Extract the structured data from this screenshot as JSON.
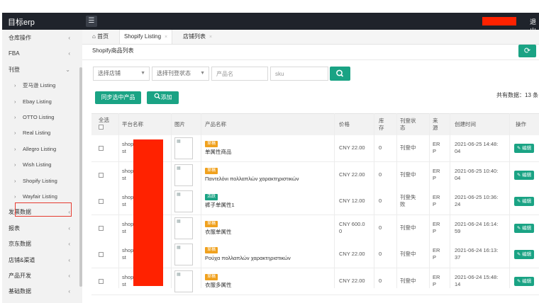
{
  "app": {
    "title": "目标erp",
    "logout": "退出",
    "menu_icon": "hamburger-icon"
  },
  "sidebar": {
    "items": [
      {
        "label": "仓库操作",
        "type": "group",
        "chevron": "‹"
      },
      {
        "label": "FBA",
        "type": "group",
        "chevron": "‹"
      },
      {
        "label": "刊登",
        "type": "group",
        "chevron": "⌄"
      },
      {
        "label": "亚马逊 Listing",
        "type": "sub"
      },
      {
        "label": "Ebay Listing",
        "type": "sub"
      },
      {
        "label": "OTTO Listing",
        "type": "sub"
      },
      {
        "label": "Real Listing",
        "type": "sub"
      },
      {
        "label": "Allegro Listing",
        "type": "sub"
      },
      {
        "label": "Wish Listing",
        "type": "sub"
      },
      {
        "label": "Shopify Listing",
        "type": "sub",
        "active": true
      },
      {
        "label": "Wayfair Listing",
        "type": "sub"
      },
      {
        "label": "发票数据",
        "type": "group",
        "chevron": "‹"
      },
      {
        "label": "报表",
        "type": "group",
        "chevron": "‹"
      },
      {
        "label": "京东数据",
        "type": "group",
        "chevron": "‹"
      },
      {
        "label": "店铺&渠道",
        "type": "group",
        "chevron": "‹"
      },
      {
        "label": "产品开发",
        "type": "group",
        "chevron": "‹"
      },
      {
        "label": "基础数据",
        "type": "group",
        "chevron": "‹"
      }
    ]
  },
  "tabs": [
    {
      "label": "首页",
      "icon": "home-icon"
    },
    {
      "label": "Shopify Listing",
      "closable": "×"
    },
    {
      "label": "店铺列表",
      "closable": "×"
    }
  ],
  "page": {
    "title": "Shopify商品列表",
    "refresh_icon": "refresh-icon"
  },
  "filters": {
    "store_select": "选择店铺",
    "status_select": "选择刊登状态",
    "product_placeholder": "产品名",
    "sku_placeholder": "sku",
    "search_icon": "search-icon"
  },
  "actions": {
    "sync": "同步选中产品",
    "add": "添加",
    "add_icon": "search-icon"
  },
  "total": "共有数据：13 条",
  "table": {
    "headers": {
      "select_all": "全选",
      "platform": "平台名称",
      "image": "图片",
      "name": "产品名称",
      "price": "价格",
      "stock": "库\n存",
      "status": "刊登状\n态",
      "source": "来\n源",
      "created": "创建时间",
      "ops": "操作"
    },
    "rows": [
      {
        "platform": "shopi\nst",
        "badge": "草稿",
        "badge_color": "#f0a11e",
        "name": "单属性商品",
        "price": "CNY 22.00",
        "stock": "0",
        "status": "刊登中",
        "source": "ER\nP",
        "created": "2021-06-25 14:48:\n04",
        "edit": "编辑"
      },
      {
        "platform": "shopi\nst",
        "badge": "草稿",
        "badge_color": "#f0a11e",
        "name": "Παντελόνι πολλαπλών χαρακτηριστικών",
        "price": "CNY 22.00",
        "stock": "0",
        "status": "刊登中",
        "source": "ER\nP",
        "created": "2021-06-25 10:40:\n04",
        "edit": "编辑"
      },
      {
        "platform": "shopi\nst",
        "badge": "活跃",
        "badge_color": "#1aa384",
        "name": "裤子单属性1",
        "price": "CNY 12.00",
        "stock": "0",
        "status": "刊登失\n败",
        "source": "ER\nP",
        "created": "2021-06-25 10:36:\n24",
        "edit": "编辑"
      },
      {
        "platform": "shopi\nst",
        "badge": "草稿",
        "badge_color": "#f0a11e",
        "name": "衣服单属性",
        "price": "CNY 600.0\n0",
        "stock": "0",
        "status": "刊登中",
        "source": "ER\nP",
        "created": "2021-06-24 16:14:\n59",
        "edit": "编辑"
      },
      {
        "platform": "shopi\nst",
        "badge": "草稿",
        "badge_color": "#f0a11e",
        "name": "Ρούχα πολλαπλών χαρακτηριστικών",
        "price": "CNY 22.00",
        "stock": "0",
        "status": "刊登中",
        "source": "ER\nP",
        "created": "2021-06-24 16:13:\n37",
        "edit": "编辑"
      },
      {
        "platform": "shopi\nst",
        "badge": "草稿",
        "badge_color": "#f0a11e",
        "name": "衣服多属性",
        "price": "CNY 22.00",
        "stock": "0",
        "status": "刊登中",
        "source": "ER\nP",
        "created": "2021-06-24 15:48:\n14",
        "edit": "编辑"
      }
    ]
  },
  "colors": {
    "accent": "#1aa384",
    "topbar": "#1f232b",
    "redaction": "#ff2200",
    "draft": "#f0a11e"
  }
}
